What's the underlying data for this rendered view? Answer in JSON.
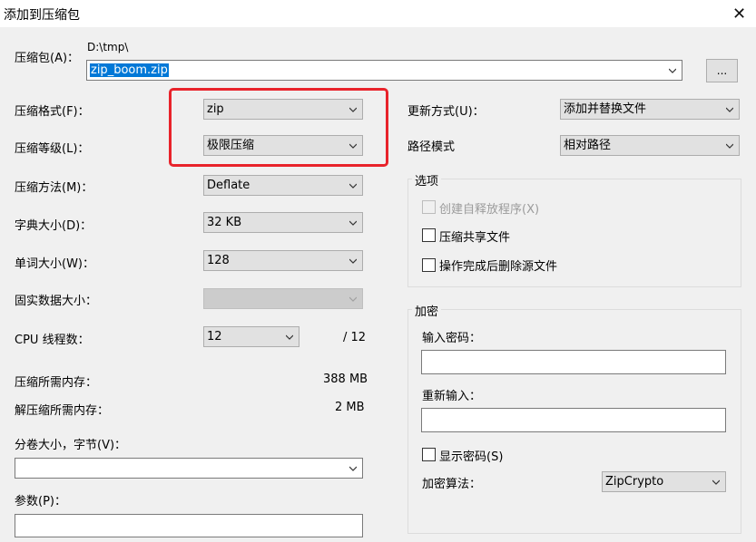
{
  "window": {
    "title": "添加到压缩包",
    "close_glyph": "✕"
  },
  "archive": {
    "label": "压缩包(A)：",
    "path": "D:\\tmp\\",
    "filename": "zip_boom.zip",
    "browse_label": "..."
  },
  "left": {
    "format": {
      "label": "压缩格式(F)：",
      "value": "zip"
    },
    "level": {
      "label": "压缩等级(L)：",
      "value": "极限压缩"
    },
    "method": {
      "label": "压缩方法(M)：",
      "value": "Deflate"
    },
    "dict": {
      "label": "字典大小(D)：",
      "value": "32 KB"
    },
    "word": {
      "label": "单词大小(W)：",
      "value": "128"
    },
    "solid": {
      "label": "固实数据大小：",
      "value": ""
    },
    "cpu": {
      "label": "CPU 线程数：",
      "value": "12",
      "max": "/ 12"
    },
    "mem_compress": {
      "label": "压缩所需内存：",
      "value": "388 MB"
    },
    "mem_decompress": {
      "label": "解压缩所需内存：",
      "value": "2 MB"
    },
    "volume": {
      "label": "分卷大小，字节(V)：",
      "value": ""
    },
    "params": {
      "label": "参数(P)：",
      "value": ""
    }
  },
  "right": {
    "update": {
      "label": "更新方式(U)：",
      "value": "添加并替换文件"
    },
    "path_mode": {
      "label": "路径模式",
      "value": "相对路径"
    },
    "options": {
      "title": "选项",
      "sfx": "创建自释放程序(X)",
      "shared": "压缩共享文件",
      "delete": "操作完成后删除源文件"
    },
    "encryption": {
      "title": "加密",
      "password_label": "输入密码：",
      "reenter_label": "重新输入：",
      "show_password": "显示密码(S)",
      "method_label": "加密算法：",
      "method_value": "ZipCrypto"
    }
  },
  "colors": {
    "highlight": "#e8232b",
    "selection": "#0078d7"
  }
}
